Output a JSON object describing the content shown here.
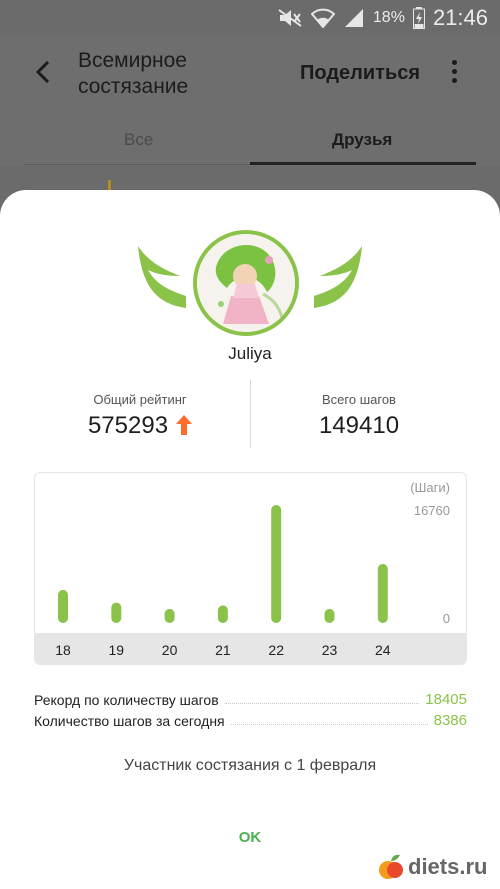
{
  "status_bar": {
    "battery_percent": "18%",
    "time": "21:46",
    "icons": [
      "mute-icon",
      "wifi-icon",
      "signal-icon",
      "battery-charging-icon"
    ]
  },
  "app_bar": {
    "title": "Всемирное состязание",
    "share_label": "Поделиться"
  },
  "tabs": [
    {
      "label": "Все",
      "active": false
    },
    {
      "label": "Друзья",
      "active": true
    }
  ],
  "profile": {
    "name": "Juliya",
    "rating_label": "Общий рейтинг",
    "rating_value": "575293",
    "rating_trend": "up",
    "total_steps_label": "Всего шагов",
    "total_steps_value": "149410"
  },
  "chart_data": {
    "type": "bar",
    "unit_label": "(Шаги)",
    "max_label": "16760",
    "zero_label": "0",
    "categories": [
      "18",
      "19",
      "20",
      "21",
      "22",
      "23",
      "24"
    ],
    "values": [
      4700,
      2900,
      2000,
      2500,
      16760,
      2000,
      8386
    ],
    "ylim": [
      0,
      16760
    ],
    "color": "#8bc34a"
  },
  "records": {
    "best_label": "Рекорд по количеству шагов",
    "best_value": "18405",
    "today_label": "Количество шагов за сегодня",
    "today_value": "8386"
  },
  "member_since": "Участник состязания с 1 февраля",
  "ok_label": "OK",
  "watermark": "diets.ru",
  "colors": {
    "accent_green": "#8bc34a",
    "ok_green": "#4caf50",
    "trend_up_orange": "#ff6d2d"
  }
}
